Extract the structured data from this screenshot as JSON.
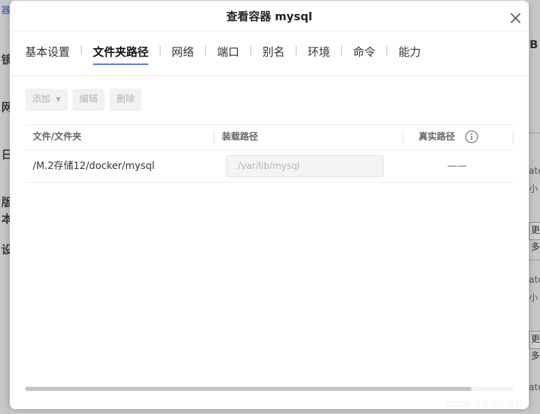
{
  "background": {
    "left_fragments": [
      "器",
      "镜",
      "网",
      "日",
      "版本",
      "设"
    ],
    "right_fragments": {
      "top": "B",
      "text_1": "ate",
      "text_2": "小",
      "button_1": "更多",
      "text_3": "ate",
      "text_4": "小",
      "button_2": "更多",
      "text_5": "ate"
    }
  },
  "modal": {
    "title": "查看容器 mysql",
    "tabs": [
      {
        "label": "基本设置",
        "active": false
      },
      {
        "label": "文件夹路径",
        "active": true
      },
      {
        "label": "网络",
        "active": false
      },
      {
        "label": "端口",
        "active": false
      },
      {
        "label": "别名",
        "active": false
      },
      {
        "label": "环境",
        "active": false
      },
      {
        "label": "命令",
        "active": false
      },
      {
        "label": "能力",
        "active": false
      }
    ],
    "toolbar": {
      "add_label": "添加",
      "edit_label": "编辑",
      "delete_label": "删除"
    },
    "table": {
      "columns": [
        "文件/文件夹",
        "装载路径",
        "真实路径"
      ],
      "rows": [
        {
          "path": "/M.2存储12/docker/mysql",
          "mount_placeholder": "/var/lib/mysql",
          "real_path": "——"
        }
      ]
    }
  },
  "watermark": "CSDN @是猿也是员",
  "colors": {
    "accent": "#4a74e0",
    "overlay": "#b4b5b7"
  }
}
